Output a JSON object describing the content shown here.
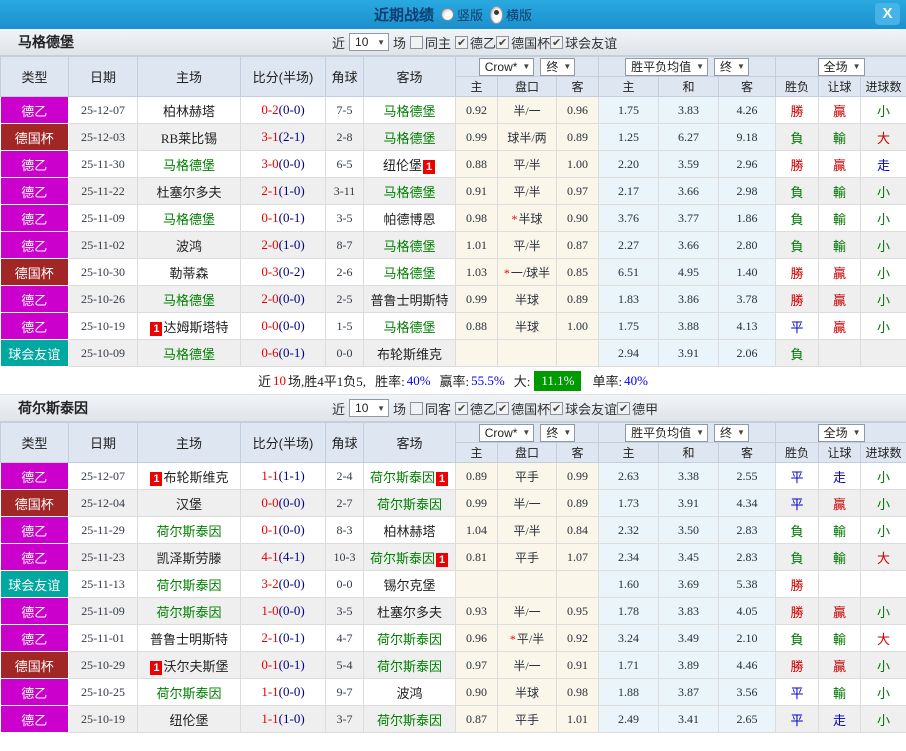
{
  "titlebar": {
    "title": "近期战绩",
    "radio_vertical": "竖版",
    "radio_horizontal": "横版",
    "selected_mode": "横版",
    "close": "X"
  },
  "table_header": {
    "type": "类型",
    "date": "日期",
    "home": "主场",
    "score": "比分(半场)",
    "corner": "角球",
    "away": "客场",
    "dd_company": "Crow*",
    "dd_final1": "终",
    "dd_avg": "胜平负均值",
    "dd_final2": "终",
    "dd_scope": "全场",
    "sub_home": "主",
    "sub_pan": "盘口",
    "sub_away": "客",
    "sub_avg_home": "主",
    "sub_avg_draw": "和",
    "sub_avg_away": "客",
    "sub_result": "胜负",
    "sub_handicap": "让球",
    "sub_goals": "进球数"
  },
  "colors": {
    "titlebar_bg": "#1e9edb",
    "league_colors": {
      "德乙": "#cc00cc",
      "德国杯": "#a22626",
      "球会友谊": "#00a8a0"
    },
    "team_highlight": "#008000",
    "score_main": "#e80000",
    "score_half": "#000080",
    "result_colors": {
      "勝": "#cc0000",
      "負": "#007700",
      "平": "#0000cc",
      "贏": "#cc0000",
      "輸": "#007700",
      "走": "#0000cc",
      "大": "#cc0000",
      "小": "#007700"
    },
    "big_badge_bg": "#009900"
  },
  "sections": [
    {
      "team": "马格德堡",
      "filters": {
        "near": "近",
        "count": "10",
        "games": "场",
        "same": "同主",
        "same_checked": false,
        "leagues": [
          {
            "label": "德乙",
            "checked": true
          },
          {
            "label": "德国杯",
            "checked": true
          },
          {
            "label": "球会友谊",
            "checked": true
          }
        ]
      },
      "rows": [
        {
          "league": "德乙",
          "date": "25-12-07",
          "home": "柏林赫塔",
          "hg": false,
          "hb": "",
          "score": "0-2",
          "half": "(0-0)",
          "corner": "7-5",
          "away": "马格德堡",
          "ag": true,
          "ab": "",
          "o1": "0.92",
          "pan": "半/一",
          "star": false,
          "o2": "0.96",
          "a1": "1.75",
          "a2": "3.83",
          "a3": "4.26",
          "r": "勝",
          "rg": "贏",
          "g": "小"
        },
        {
          "league": "德国杯",
          "date": "25-12-03",
          "home": "RB莱比锡",
          "hg": false,
          "hb": "",
          "score": "3-1",
          "half": "(2-1)",
          "corner": "2-8",
          "away": "马格德堡",
          "ag": true,
          "ab": "",
          "o1": "0.99",
          "pan": "球半/两",
          "star": false,
          "o2": "0.89",
          "a1": "1.25",
          "a2": "6.27",
          "a3": "9.18",
          "r": "負",
          "rg": "輸",
          "g": "大"
        },
        {
          "league": "德乙",
          "date": "25-11-30",
          "home": "马格德堡",
          "hg": true,
          "hb": "",
          "score": "3-0",
          "half": "(0-0)",
          "corner": "6-5",
          "away": "纽伦堡",
          "ag": false,
          "ab": "1",
          "o1": "0.88",
          "pan": "平/半",
          "star": false,
          "o2": "1.00",
          "a1": "2.20",
          "a2": "3.59",
          "a3": "2.96",
          "r": "勝",
          "rg": "贏",
          "g": "走"
        },
        {
          "league": "德乙",
          "date": "25-11-22",
          "home": "杜塞尔多夫",
          "hg": false,
          "hb": "",
          "score": "2-1",
          "half": "(1-0)",
          "corner": "3-11",
          "away": "马格德堡",
          "ag": true,
          "ab": "",
          "o1": "0.91",
          "pan": "平/半",
          "star": false,
          "o2": "0.97",
          "a1": "2.17",
          "a2": "3.66",
          "a3": "2.98",
          "r": "負",
          "rg": "輸",
          "g": "小"
        },
        {
          "league": "德乙",
          "date": "25-11-09",
          "home": "马格德堡",
          "hg": true,
          "hb": "",
          "score": "0-1",
          "half": "(0-1)",
          "corner": "3-5",
          "away": "帕德博恩",
          "ag": false,
          "ab": "",
          "o1": "0.98",
          "pan": "半球",
          "star": true,
          "o2": "0.90",
          "a1": "3.76",
          "a2": "3.77",
          "a3": "1.86",
          "r": "負",
          "rg": "輸",
          "g": "小"
        },
        {
          "league": "德乙",
          "date": "25-11-02",
          "home": "波鸿",
          "hg": false,
          "hb": "",
          "score": "2-0",
          "half": "(1-0)",
          "corner": "8-7",
          "away": "马格德堡",
          "ag": true,
          "ab": "",
          "o1": "1.01",
          "pan": "平/半",
          "star": false,
          "o2": "0.87",
          "a1": "2.27",
          "a2": "3.66",
          "a3": "2.80",
          "r": "負",
          "rg": "輸",
          "g": "小"
        },
        {
          "league": "德国杯",
          "date": "25-10-30",
          "home": "勒蒂森",
          "hg": false,
          "hb": "",
          "score": "0-3",
          "half": "(0-2)",
          "corner": "2-6",
          "away": "马格德堡",
          "ag": true,
          "ab": "",
          "o1": "1.03",
          "pan": "一/球半",
          "star": true,
          "o2": "0.85",
          "a1": "6.51",
          "a2": "4.95",
          "a3": "1.40",
          "r": "勝",
          "rg": "贏",
          "g": "小"
        },
        {
          "league": "德乙",
          "date": "25-10-26",
          "home": "马格德堡",
          "hg": true,
          "hb": "",
          "score": "2-0",
          "half": "(0-0)",
          "corner": "2-5",
          "away": "普鲁士明斯特",
          "ag": false,
          "ab": "",
          "o1": "0.99",
          "pan": "半球",
          "star": false,
          "o2": "0.89",
          "a1": "1.83",
          "a2": "3.86",
          "a3": "3.78",
          "r": "勝",
          "rg": "贏",
          "g": "小"
        },
        {
          "league": "德乙",
          "date": "25-10-19",
          "home": "达姆斯塔特",
          "hg": false,
          "hb": "1",
          "score": "0-0",
          "half": "(0-0)",
          "corner": "1-5",
          "away": "马格德堡",
          "ag": true,
          "ab": "",
          "o1": "0.88",
          "pan": "半球",
          "star": false,
          "o2": "1.00",
          "a1": "1.75",
          "a2": "3.88",
          "a3": "4.13",
          "r": "平",
          "rg": "贏",
          "g": "小"
        },
        {
          "league": "球会友谊",
          "date": "25-10-09",
          "home": "马格德堡",
          "hg": true,
          "hb": "",
          "score": "0-6",
          "half": "(0-1)",
          "corner": "0-0",
          "away": "布轮斯维克",
          "ag": false,
          "ab": "",
          "o1": "",
          "pan": "",
          "star": false,
          "o2": "",
          "a1": "2.94",
          "a2": "3.91",
          "a3": "2.06",
          "r": "負",
          "rg": "",
          "g": ""
        }
      ],
      "summary": {
        "label_near": "近",
        "count": "10",
        "record": "场,胜4平1负5,",
        "label_winrate": "胜率:",
        "winrate": "40%",
        "label_yingrate": "赢率:",
        "yingrate": "55.5%",
        "label_big": "大:",
        "big": "11.1%",
        "label_single": "单率:",
        "single": "40%"
      }
    },
    {
      "team": "荷尔斯泰因",
      "filters": {
        "near": "近",
        "count": "10",
        "games": "场",
        "same": "同客",
        "same_checked": false,
        "leagues": [
          {
            "label": "德乙",
            "checked": true
          },
          {
            "label": "德国杯",
            "checked": true
          },
          {
            "label": "球会友谊",
            "checked": true
          },
          {
            "label": "德甲",
            "checked": true
          }
        ]
      },
      "rows": [
        {
          "league": "德乙",
          "date": "25-12-07",
          "home": "布轮斯维克",
          "hg": false,
          "hb": "1",
          "score": "1-1",
          "half": "(1-1)",
          "corner": "2-4",
          "away": "荷尔斯泰因",
          "ag": true,
          "ab": "1",
          "o1": "0.89",
          "pan": "平手",
          "star": false,
          "o2": "0.99",
          "a1": "2.63",
          "a2": "3.38",
          "a3": "2.55",
          "r": "平",
          "rg": "走",
          "g": "小"
        },
        {
          "league": "德国杯",
          "date": "25-12-04",
          "home": "汉堡",
          "hg": false,
          "hb": "",
          "score": "0-0",
          "half": "(0-0)",
          "corner": "2-7",
          "away": "荷尔斯泰因",
          "ag": true,
          "ab": "",
          "o1": "0.99",
          "pan": "半/一",
          "star": false,
          "o2": "0.89",
          "a1": "1.73",
          "a2": "3.91",
          "a3": "4.34",
          "r": "平",
          "rg": "贏",
          "g": "小"
        },
        {
          "league": "德乙",
          "date": "25-11-29",
          "home": "荷尔斯泰因",
          "hg": true,
          "hb": "",
          "score": "0-1",
          "half": "(0-0)",
          "corner": "8-3",
          "away": "柏林赫塔",
          "ag": false,
          "ab": "",
          "o1": "1.04",
          "pan": "平/半",
          "star": false,
          "o2": "0.84",
          "a1": "2.32",
          "a2": "3.50",
          "a3": "2.83",
          "r": "負",
          "rg": "輸",
          "g": "小"
        },
        {
          "league": "德乙",
          "date": "25-11-23",
          "home": "凯泽斯劳滕",
          "hg": false,
          "hb": "",
          "score": "4-1",
          "half": "(4-1)",
          "corner": "10-3",
          "away": "荷尔斯泰因",
          "ag": true,
          "ab": "1",
          "o1": "0.81",
          "pan": "平手",
          "star": false,
          "o2": "1.07",
          "a1": "2.34",
          "a2": "3.45",
          "a3": "2.83",
          "r": "負",
          "rg": "輸",
          "g": "大"
        },
        {
          "league": "球会友谊",
          "date": "25-11-13",
          "home": "荷尔斯泰因",
          "hg": true,
          "hb": "",
          "score": "3-2",
          "half": "(0-0)",
          "corner": "0-0",
          "away": "锡尔克堡",
          "ag": false,
          "ab": "",
          "o1": "",
          "pan": "",
          "star": false,
          "o2": "",
          "a1": "1.60",
          "a2": "3.69",
          "a3": "5.38",
          "r": "勝",
          "rg": "",
          "g": ""
        },
        {
          "league": "德乙",
          "date": "25-11-09",
          "home": "荷尔斯泰因",
          "hg": true,
          "hb": "",
          "score": "1-0",
          "half": "(0-0)",
          "corner": "3-5",
          "away": "杜塞尔多夫",
          "ag": false,
          "ab": "",
          "o1": "0.93",
          "pan": "半/一",
          "star": false,
          "o2": "0.95",
          "a1": "1.78",
          "a2": "3.83",
          "a3": "4.05",
          "r": "勝",
          "rg": "贏",
          "g": "小"
        },
        {
          "league": "德乙",
          "date": "25-11-01",
          "home": "普鲁士明斯特",
          "hg": false,
          "hb": "",
          "score": "2-1",
          "half": "(0-1)",
          "corner": "4-7",
          "away": "荷尔斯泰因",
          "ag": true,
          "ab": "",
          "o1": "0.96",
          "pan": "平/半",
          "star": true,
          "o2": "0.92",
          "a1": "3.24",
          "a2": "3.49",
          "a3": "2.10",
          "r": "負",
          "rg": "輸",
          "g": "大"
        },
        {
          "league": "德国杯",
          "date": "25-10-29",
          "home": "沃尔夫斯堡",
          "hg": false,
          "hb": "1",
          "score": "0-1",
          "half": "(0-1)",
          "corner": "5-4",
          "away": "荷尔斯泰因",
          "ag": true,
          "ab": "",
          "o1": "0.97",
          "pan": "半/一",
          "star": false,
          "o2": "0.91",
          "a1": "1.71",
          "a2": "3.89",
          "a3": "4.46",
          "r": "勝",
          "rg": "贏",
          "g": "小"
        },
        {
          "league": "德乙",
          "date": "25-10-25",
          "home": "荷尔斯泰因",
          "hg": true,
          "hb": "",
          "score": "1-1",
          "half": "(0-0)",
          "corner": "9-7",
          "away": "波鸿",
          "ag": false,
          "ab": "",
          "o1": "0.90",
          "pan": "半球",
          "star": false,
          "o2": "0.98",
          "a1": "1.88",
          "a2": "3.87",
          "a3": "3.56",
          "r": "平",
          "rg": "輸",
          "g": "小"
        },
        {
          "league": "德乙",
          "date": "25-10-19",
          "home": "纽伦堡",
          "hg": false,
          "hb": "",
          "score": "1-1",
          "half": "(1-0)",
          "corner": "3-7",
          "away": "荷尔斯泰因",
          "ag": true,
          "ab": "",
          "o1": "0.87",
          "pan": "平手",
          "star": false,
          "o2": "1.01",
          "a1": "2.49",
          "a2": "3.41",
          "a3": "2.65",
          "r": "平",
          "rg": "走",
          "g": "小"
        }
      ]
    }
  ]
}
